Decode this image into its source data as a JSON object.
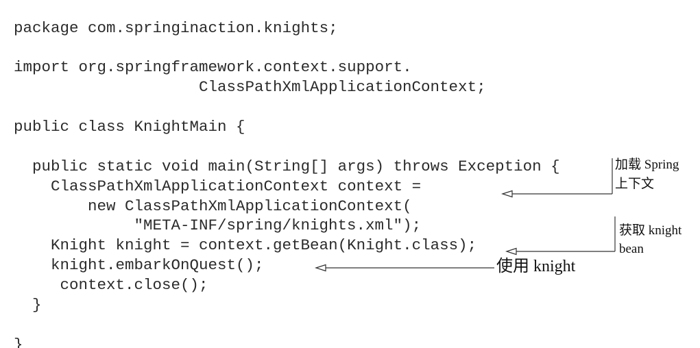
{
  "listing": {
    "lines": [
      "package com.springinaction.knights;",
      "import org.springframework.context.support.",
      "ClassPathXmlApplicationContext;",
      "public class KnightMain {",
      "public static void main(String[] args) throws Exception {",
      "ClassPathXmlApplicationContext context =",
      "new ClassPathXmlApplicationContext(",
      "\"META-INF/spring/knights.xml\");",
      "Knight knight = context.getBean(Knight.class);",
      "knight.embarkOnQuest();",
      "context.close();",
      "}",
      "}"
    ]
  },
  "annotations": {
    "load_context": [
      "加载 Spring",
      "上下文"
    ],
    "get_bean": [
      "获取 knight",
      "bean"
    ],
    "use_bean": [
      "使用 knight"
    ]
  }
}
